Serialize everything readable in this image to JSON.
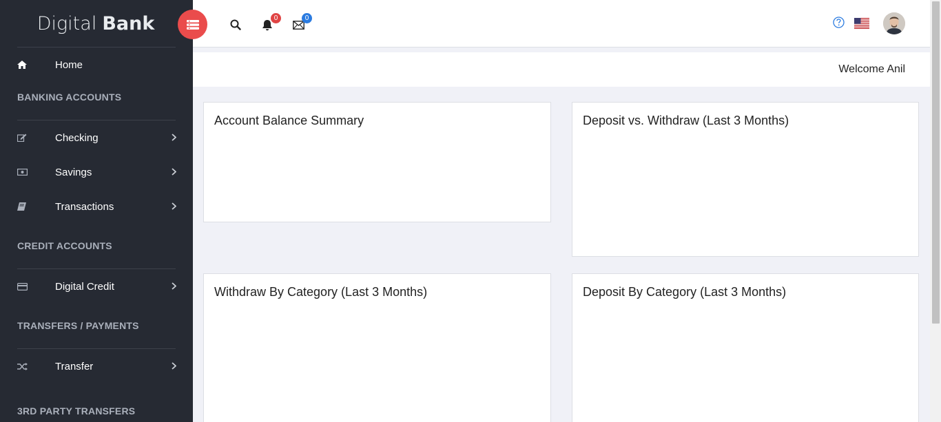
{
  "brand": {
    "light": "Digital",
    "bold": "Bank"
  },
  "sidebar": {
    "home": {
      "label": "Home",
      "icon": "home-icon"
    },
    "sections": [
      {
        "title": "BANKING ACCOUNTS",
        "items": [
          {
            "label": "Checking",
            "icon": "edit-icon"
          },
          {
            "label": "Savings",
            "icon": "money-icon"
          },
          {
            "label": "Transactions",
            "icon": "book-icon"
          }
        ]
      },
      {
        "title": "CREDIT ACCOUNTS",
        "items": [
          {
            "label": "Digital Credit",
            "icon": "credit-card-icon"
          }
        ]
      },
      {
        "title": "TRANSFERS / PAYMENTS",
        "items": [
          {
            "label": "Transfer",
            "icon": "shuffle-icon"
          }
        ]
      },
      {
        "title": "3RD PARTY TRANSFERS",
        "items": []
      }
    ]
  },
  "topbar": {
    "notifications_count": "0",
    "messages_count": "0"
  },
  "welcome": "Welcome Anil",
  "cards": {
    "balance_summary": "Account Balance Summary",
    "deposit_vs_withdraw": "Deposit vs. Withdraw (Last 3 Months)",
    "withdraw_by_category": "Withdraw By Category (Last 3 Months)",
    "deposit_by_category": "Deposit By Category (Last 3 Months)"
  },
  "colors": {
    "sidebar_bg": "#262a33",
    "accent_red": "#ea4c4c",
    "badge_blue": "#2b7be0"
  }
}
